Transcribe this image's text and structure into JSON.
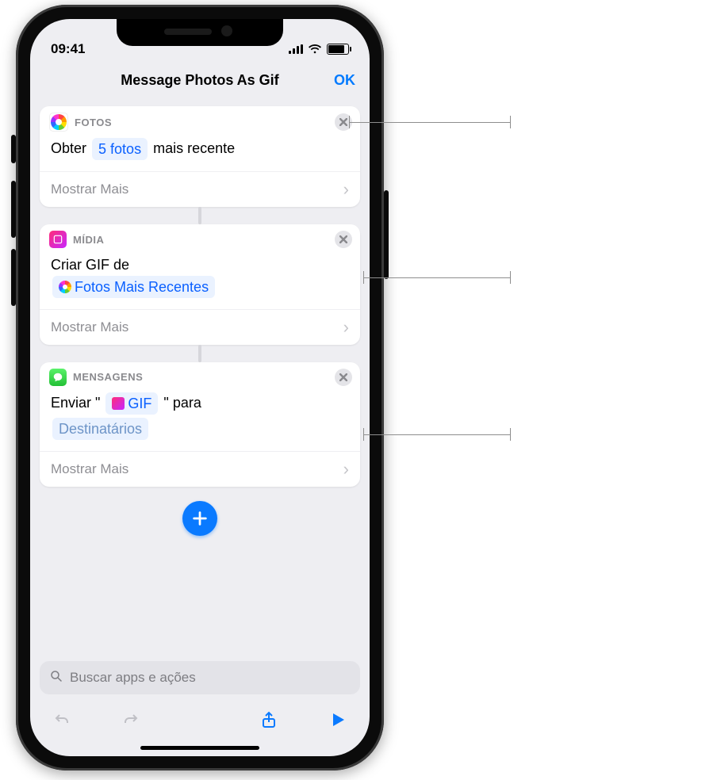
{
  "status": {
    "time": "09:41"
  },
  "nav": {
    "title": "Message Photos As Gif",
    "ok": "OK"
  },
  "cards": [
    {
      "app_label": "FOTOS",
      "body_parts": {
        "pre": "Obter ",
        "token": "5 fotos",
        "post": " mais recente"
      },
      "more": "Mostrar Mais"
    },
    {
      "app_label": "MÍDIA",
      "body_parts": {
        "pre": "Criar GIF de",
        "token": "Fotos Mais Recentes"
      },
      "more": "Mostrar Mais"
    },
    {
      "app_label": "MENSAGENS",
      "body_parts": {
        "pre": "Enviar \" ",
        "token": "GIF",
        "mid": " \" para",
        "token2": "Destinatários"
      },
      "more": "Mostrar Mais"
    }
  ],
  "search": {
    "placeholder": "Buscar apps e ações"
  }
}
